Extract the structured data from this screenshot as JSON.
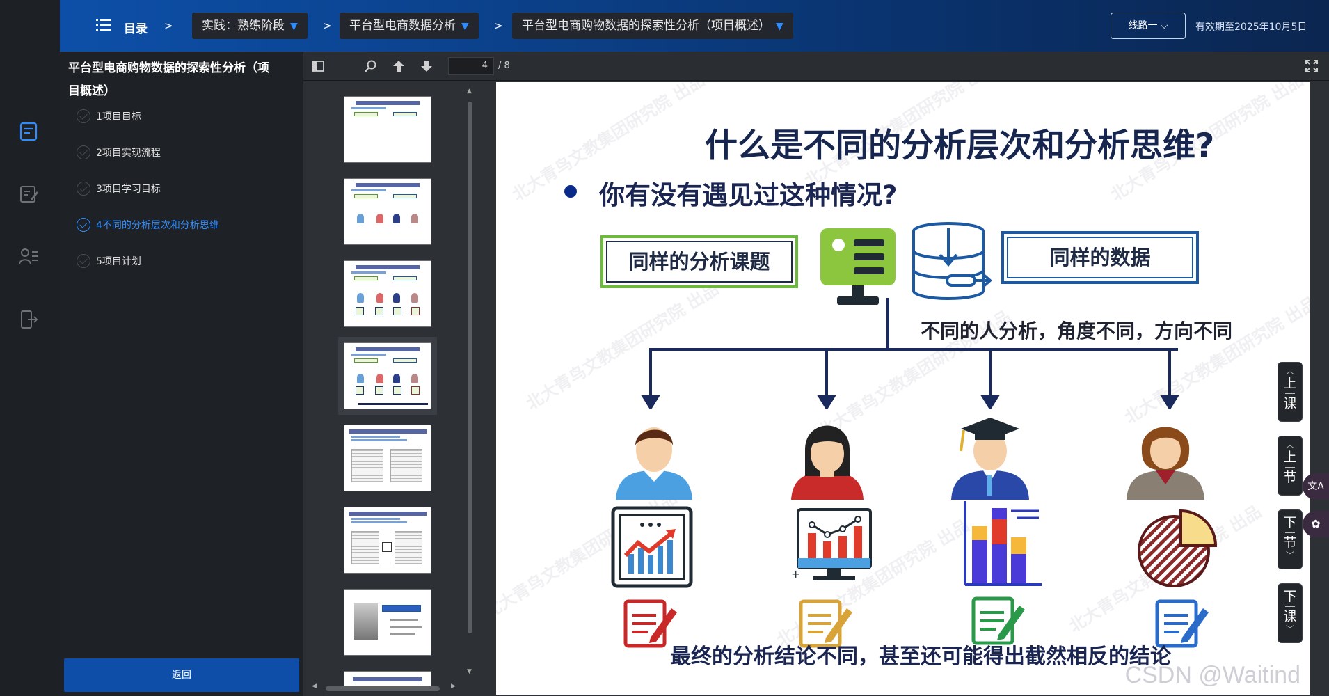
{
  "header": {
    "toc_label": "目录",
    "breadcrumbs": [
      {
        "label": "实践：熟练阶段"
      },
      {
        "label": "平台型电商数据分析"
      },
      {
        "label": "平台型电商购物数据的探索性分析（项目概述）"
      }
    ],
    "separator": ">",
    "route_label": "线路一",
    "expiry": "有效期至2025年10月5日"
  },
  "sidebar": {
    "title": "平台型电商购物数据的探索性分析（项目概述）",
    "items": [
      {
        "label": "1项目目标",
        "active": false
      },
      {
        "label": "2项目实现流程",
        "active": false
      },
      {
        "label": "3项目学习目标",
        "active": false
      },
      {
        "label": "4不同的分析层次和分析思维",
        "active": true
      },
      {
        "label": "5项目计划",
        "active": false
      }
    ],
    "back_label": "返回"
  },
  "viewer": {
    "page_current": "4",
    "page_total": "/ 8"
  },
  "slide": {
    "title": "什么是不同的分析层次和分析思维?",
    "subtitle": "你有没有遇见过这种情况?",
    "box_left": "同样的分析课题",
    "box_right": "同样的数据",
    "middle_caption": "不同的人分析，角度不同，方向不同",
    "bottom_caption": "最终的分析结论不同，甚至还可能得出截然相反的结论",
    "watermark": "北大青鸟文教集团研究院 出品",
    "credit": "CSDN @Waitind"
  },
  "side_nav": {
    "prev_lesson": [
      "上",
      "课"
    ],
    "prev_section": [
      "上",
      "节"
    ],
    "next_section": [
      "下",
      "节"
    ],
    "next_lesson": [
      "下",
      "课"
    ],
    "translate": "文A"
  },
  "colors": {
    "accent_blue": "#2f8cff",
    "header_blue": "#0d4fa8",
    "green": "#6dbb3a",
    "navy": "#17264f"
  }
}
